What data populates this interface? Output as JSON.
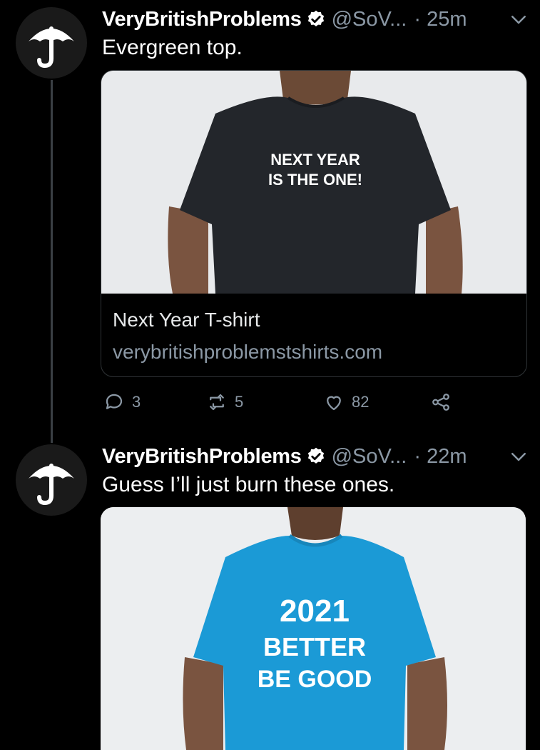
{
  "colors": {
    "background": "#000000",
    "secondary_text": "#8b98a5",
    "verified": "#ffffff"
  },
  "tweets": [
    {
      "display_name": "VeryBritishProblems",
      "handle": "@SoV...",
      "time": "· 25m",
      "text": "Evergreen top.",
      "avatar_icon": "umbrella-icon",
      "card": {
        "shirt_text_line1": "NEXT YEAR",
        "shirt_text_line2": "IS THE ONE!",
        "title": "Next Year T-shirt",
        "domain": "verybritishproblemstshirts.com"
      },
      "actions": {
        "replies": "3",
        "retweets": "5",
        "likes": "82"
      }
    },
    {
      "display_name": "VeryBritishProblems",
      "handle": "@SoV...",
      "time": "· 22m",
      "text": "Guess I’ll just burn these ones.",
      "avatar_icon": "umbrella-icon",
      "image": {
        "shirt_text_line1": "2021",
        "shirt_text_line2": "BETTER",
        "shirt_text_line3": "BE GOOD"
      }
    }
  ]
}
